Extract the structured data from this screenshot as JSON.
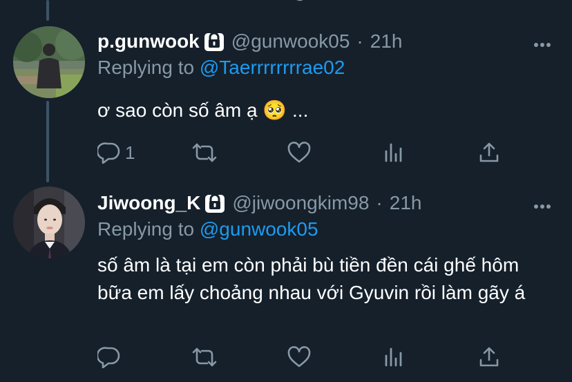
{
  "tweets": [
    {
      "display_name": "p.gunwook",
      "handle": "@gunwook05",
      "separator": "·",
      "time": "21h",
      "replying_prefix": "Replying to",
      "replying_to": "@Taerrrrrrrrae02",
      "text": "ơ sao còn số âm ạ 🥺 ...",
      "reply_count": "1",
      "locked": true
    },
    {
      "display_name": "Jiwoong_K",
      "handle": "@jiwoongkim98",
      "separator": "·",
      "time": "21h",
      "replying_prefix": "Replying to",
      "replying_to": "@gunwook05",
      "text": "số âm là tại em còn phải bù tiền đền cái ghế hôm bữa em lấy choảng nhau với Gyuvin rồi làm gãy á",
      "reply_count": "",
      "locked": true
    }
  ],
  "icons": {
    "lock": "lock-icon",
    "more": "more-icon",
    "reply": "reply-icon",
    "retweet": "retweet-icon",
    "like": "heart-icon",
    "analytics": "analytics-icon",
    "share": "share-icon"
  },
  "colors": {
    "background": "#15202b",
    "text": "#ffffff",
    "secondary": "#8899a6",
    "link": "#1d9bf0",
    "thread_line": "#3d5466"
  }
}
